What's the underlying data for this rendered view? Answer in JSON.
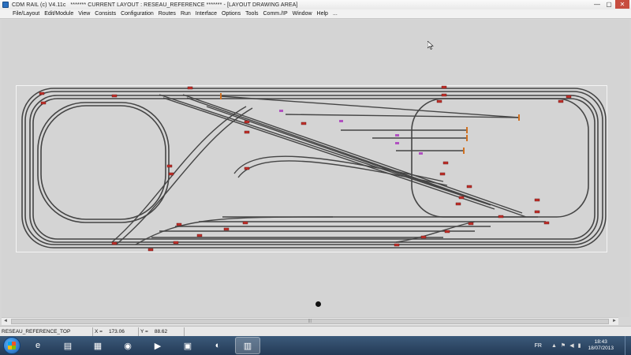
{
  "window": {
    "app_name": "CDM RAIL (c) V4.11c",
    "layout_title": "******* CURRENT LAYOUT : RESEAU_REFERENCE ******* - [LAYOUT DRAWING AREA]",
    "minimize_glyph": "—",
    "maximize_glyph": "▢",
    "close_glyph": "✕"
  },
  "menu": {
    "items": [
      "File/Layout",
      "Edit/Module",
      "View",
      "Consists",
      "Configuration",
      "Routes",
      "Run",
      "Interface",
      "Options",
      "Tools",
      "Comm./IP",
      "Window",
      "Help",
      "..."
    ]
  },
  "status": {
    "layout_name": "RESEAU_REFERENCE_TOP",
    "x_label": "X =",
    "x_value": "173.06",
    "y_label": "Y =",
    "y_value": "88.62"
  },
  "scroll": {
    "left_glyph": "◄",
    "right_glyph": "►",
    "grip": "|||"
  },
  "taskbar": {
    "apps": [
      {
        "icon": "internet-explorer-icon",
        "glyph": "e"
      },
      {
        "icon": "file-explorer-icon",
        "glyph": "▤"
      },
      {
        "icon": "app-icon",
        "glyph": "▦"
      },
      {
        "icon": "chrome-icon",
        "glyph": "◉"
      },
      {
        "icon": "media-player-icon",
        "glyph": "▶"
      },
      {
        "icon": "network-app-icon",
        "glyph": "▣"
      },
      {
        "icon": "green-app-icon",
        "glyph": "◐"
      },
      {
        "icon": "cdm-rail-icon",
        "glyph": "▥"
      }
    ],
    "language": "FR",
    "time": "18:43",
    "date": "18/07/2013"
  },
  "colors": {
    "track": "#4a4a4a",
    "track_edge": "#2a2a2a",
    "signal": "#c0302a",
    "marker": "#b050c0",
    "buffer": "#d07020"
  }
}
